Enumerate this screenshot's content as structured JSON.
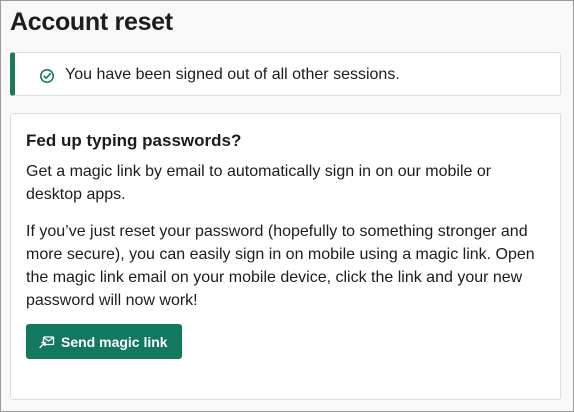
{
  "page": {
    "title": "Account reset"
  },
  "alert": {
    "icon": "check-circle-icon",
    "message": "You have been signed out of all other sessions.",
    "accent_color": "#1a7a5e"
  },
  "card": {
    "title": "Fed up typing passwords?",
    "paragraph_1": "Get a magic link by email to automatically sign in on our mobile or desktop apps.",
    "paragraph_2": "If you’ve just reset your password (hopefully to something stronger and more secure), you can easily sign in on mobile using a magic link. Open the magic link email on your mobile device, click the link and your new password will now work!",
    "button": {
      "label": "Send magic link",
      "icon": "magic-link-icon",
      "color": "#12785e"
    }
  }
}
